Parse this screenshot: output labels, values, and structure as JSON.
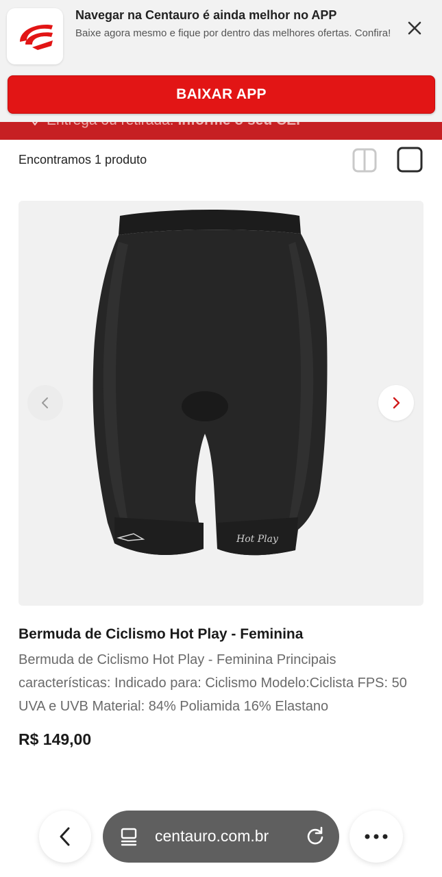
{
  "app_banner": {
    "title": "Navegar na Centauro é ainda melhor no APP",
    "subtitle": "Baixe agora mesmo e fique por dentro das melhores ofertas. Confira!",
    "download_label": "BAIXAR APP",
    "logo_icon": "centauro-logo",
    "close_icon": "close-icon",
    "brand_color": "#e21515"
  },
  "delivery_bar": {
    "label": "Entrega ou retirada:",
    "action": "Informe o seu CEP",
    "icon": "location-pin-icon",
    "color": "#c62023"
  },
  "results": {
    "count_text": "Encontramos 1 produto",
    "view_icons": [
      "two-column-grid-icon",
      "single-column-icon"
    ],
    "selected_view": "single-column"
  },
  "product": {
    "image_alt": "Bermuda de Ciclismo Hot Play - Feminina",
    "image_brand_mark": "Hot Play",
    "name": "Bermuda de Ciclismo Hot Play - Feminina",
    "description": "Bermuda de Ciclismo Hot Play - Feminina Principais características: Indicado para: Ciclismo Modelo:Ciclista FPS: 50 UVA e UVB Material: 84% Poliamida 16% Elastano",
    "price": "R$ 149,00",
    "carousel_prev_icon": "chevron-left-icon",
    "carousel_next_icon": "chevron-right-icon"
  },
  "browser": {
    "url": "centauro.com.br",
    "back_icon": "back-arrow-icon",
    "page_icon": "page-info-icon",
    "reload_icon": "reload-icon",
    "menu_icon": "more-horizontal-icon"
  }
}
